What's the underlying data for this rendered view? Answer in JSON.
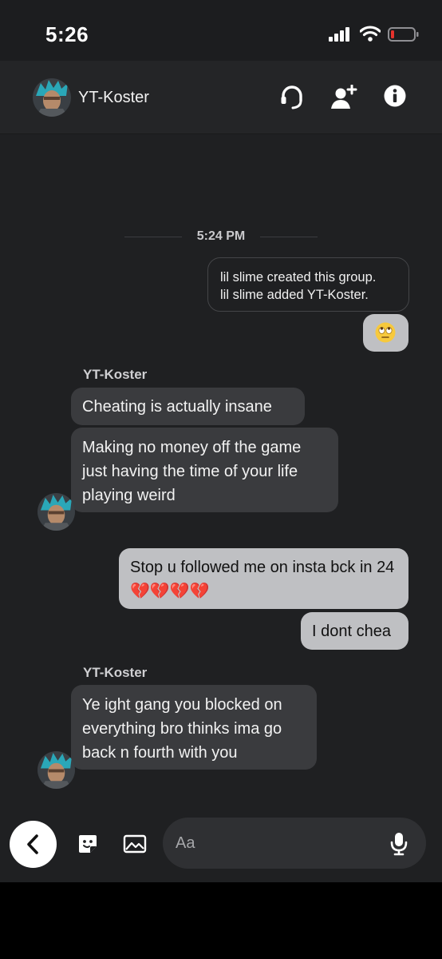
{
  "status_bar": {
    "time": "5:26",
    "icons": [
      "cellular-signal-icon",
      "wifi-icon",
      "battery-low-icon"
    ],
    "battery_color": "#e5322c"
  },
  "header": {
    "contact_name": "YT-Koster",
    "icons": [
      "headset-icon",
      "add-friend-icon",
      "info-icon"
    ]
  },
  "conversation": {
    "timestamp": "5:24 PM",
    "system_notes": [
      "lil slime created this group.",
      "lil slime added YT-Koster."
    ],
    "messages": [
      {
        "direction": "out",
        "text": "🙄"
      },
      {
        "direction": "in",
        "sender": "YT-Koster",
        "text": "Cheating is actually insane"
      },
      {
        "direction": "in",
        "text": "Making no money off the game just having the time of your life playing weird"
      },
      {
        "direction": "out",
        "text": "Stop u followed me on insta bck in 24💔💔💔💔"
      },
      {
        "direction": "out",
        "text": "I dont chea"
      },
      {
        "direction": "in",
        "sender": "YT-Koster",
        "text": "Ye ight gang you blocked on everything bro thinks ima go back n fourth with you"
      }
    ]
  },
  "composer": {
    "placeholder": "Aa",
    "icons": [
      "back-chevron-icon",
      "sticker-icon",
      "image-icon",
      "microphone-icon"
    ]
  },
  "colors": {
    "background": "#1f2022",
    "incoming_bubble": "#3a3b3e",
    "outgoing_bubble": "#bfc0c3"
  }
}
